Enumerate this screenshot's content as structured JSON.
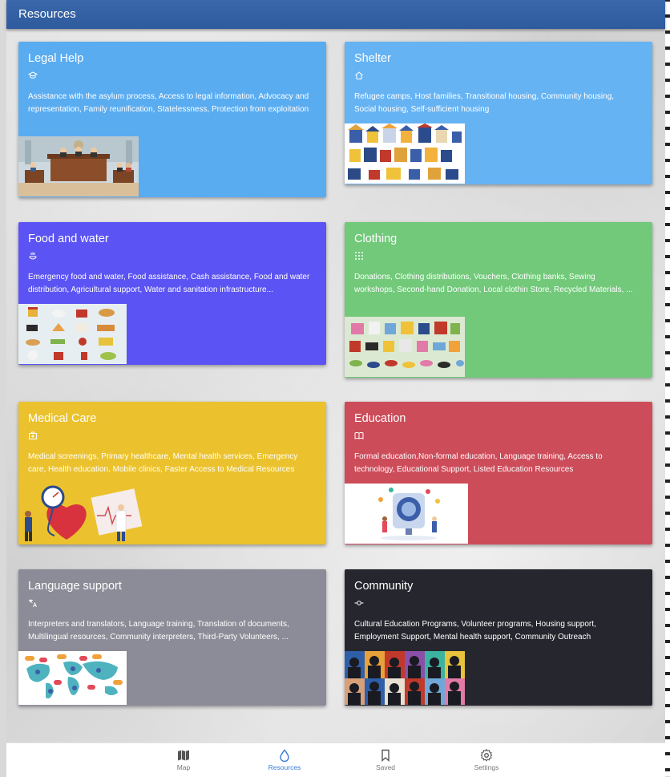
{
  "header": {
    "title": "Resources"
  },
  "cards": [
    {
      "title": "Legal Help",
      "icon": "graduation-cap-icon",
      "color": "#5aacf1",
      "description": "Assistance with the asylum process, Access to legal information, Advocacy and representation, Family reunification, Statelessness, Protection from exploitation",
      "image": "courtroom-illustration"
    },
    {
      "title": "Shelter",
      "icon": "home-icon",
      "color": "#66b3f3",
      "description": "Refugee camps, Host families, Transitional housing, Community housing, Social housing, Self-sufficient housing",
      "image": "houses-illustration"
    },
    {
      "title": "Food and water",
      "icon": "food-icon",
      "color": "#5b53f3",
      "description": "Emergency food and water, Food assistance, Cash assistance, Food and water distribution, Agricultural support, Water and sanitation infrastructure...",
      "image": "food-items-illustration"
    },
    {
      "title": "Clothing",
      "icon": "grid-icon",
      "color": "#72c97a",
      "description": "Donations, Clothing distributions, Vouchers, Clothing banks, Sewing workshops, Second-hand Donation, Local clothin Store, Recycled Materials, ...",
      "image": "clothes-illustration"
    },
    {
      "title": "Medical Care",
      "icon": "medical-bag-icon",
      "color": "#ebc22d",
      "description": "Medical screenings, Primary healthcare, Mental health services, Emergency care, Health education, Mobile clinics, Faster Access to Medical Resources",
      "image": "heart-doctor-illustration"
    },
    {
      "title": "Education",
      "icon": "book-icon",
      "color": "#cd4c5a",
      "description": "Formal education,Non-formal education, Language training, Access to technology, Educational Support, Listed Education Resources",
      "image": "education-illustration"
    },
    {
      "title": "Language support",
      "icon": "translate-icon",
      "color": "#8c8c98",
      "description": "Interpreters and translators, Language training, Translation of documents, Multilingual resources, Community interpreters, Third-Party Volunteers, ...",
      "image": "world-map-speech-illustration"
    },
    {
      "title": "Community",
      "icon": "commit-icon",
      "color": "#26262e",
      "description": "Cultural Education Programs, Volunteer programs, Housing support, Employment Support, Mental health support, Community Outreach",
      "image": "crowd-silhouettes-illustration"
    }
  ],
  "bottom_nav": [
    {
      "label": "Map",
      "icon": "map-icon",
      "active": false
    },
    {
      "label": "Resources",
      "icon": "drop-icon",
      "active": true
    },
    {
      "label": "Saved",
      "icon": "bookmark-icon",
      "active": false
    },
    {
      "label": "Settings",
      "icon": "gear-icon",
      "active": false
    }
  ],
  "colors": {
    "header": "#2f5c9f",
    "active_nav": "#3b7bd6",
    "inactive_nav": "#777777"
  }
}
